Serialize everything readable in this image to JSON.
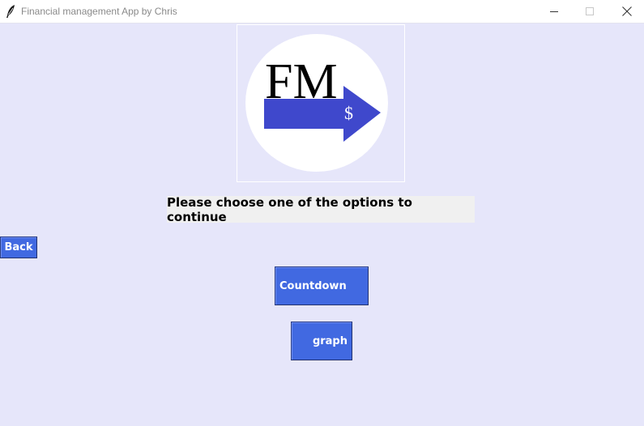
{
  "window": {
    "title": "Financial management App by Chris",
    "controls": [
      "minimize",
      "maximize",
      "close"
    ]
  },
  "logo": {
    "letters": "FM",
    "currency_symbol": "$",
    "colors": {
      "circle": "#ffffff",
      "arrow": "#3f48cc",
      "letters": "#000000",
      "symbol": "#ffffff"
    }
  },
  "main": {
    "prompt": "Please choose one of the options to continue"
  },
  "buttons": {
    "back": "Back",
    "countdown": "Countdown",
    "graph": "graph"
  },
  "colors": {
    "background": "#e6e6fa",
    "button": "#4169e1",
    "button_text": "#ffffff",
    "prompt_background": "#f0f0f0"
  }
}
